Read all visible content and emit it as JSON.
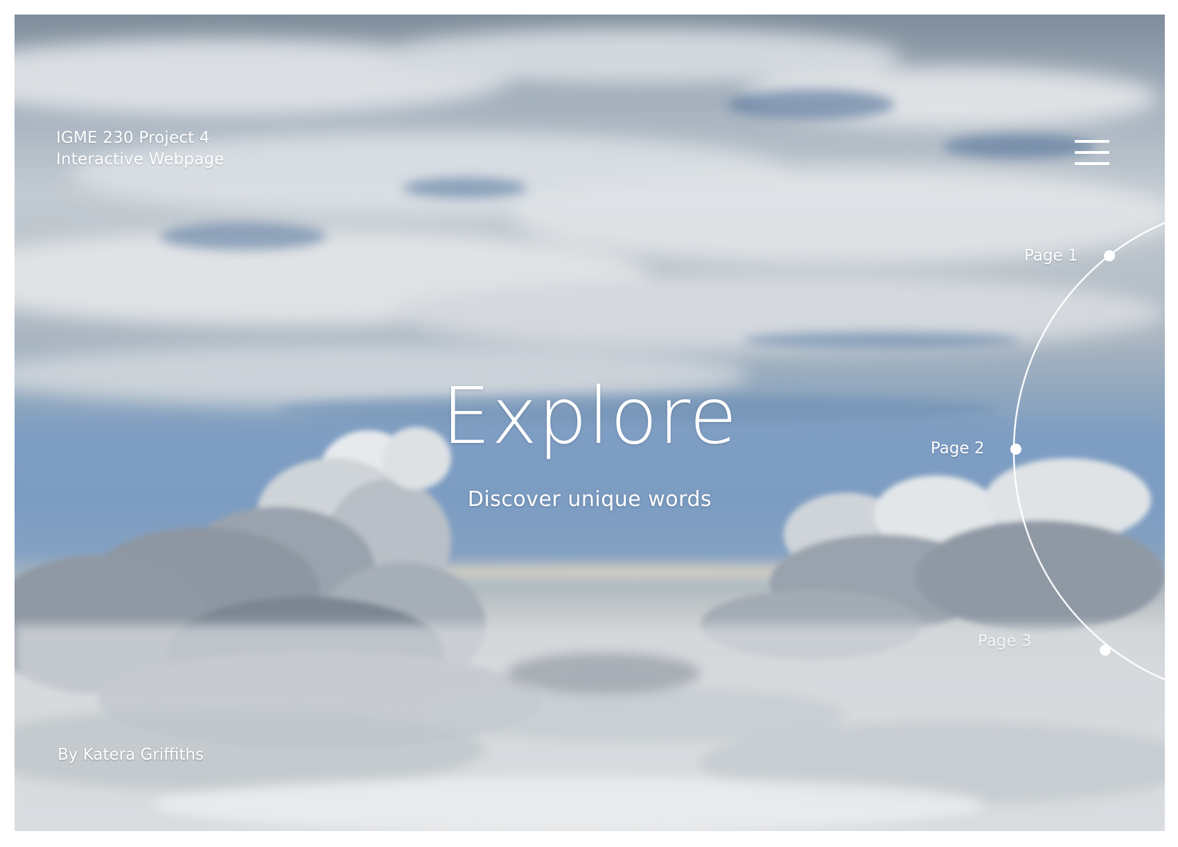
{
  "header": {
    "line1": "IGME 230 Project 4",
    "line2": "Interactive Webpage"
  },
  "menu": {
    "icon": "hamburger-menu-icon"
  },
  "hero": {
    "title": "Explore",
    "subtitle": "Discover unique words"
  },
  "footer": {
    "byline": "By Katera Griffiths"
  },
  "page_nav": {
    "items": [
      {
        "label": "Page 1"
      },
      {
        "label": "Page 2"
      },
      {
        "label": "Page 3"
      }
    ]
  },
  "background": {
    "image": "sky-above-clouds-photo"
  }
}
